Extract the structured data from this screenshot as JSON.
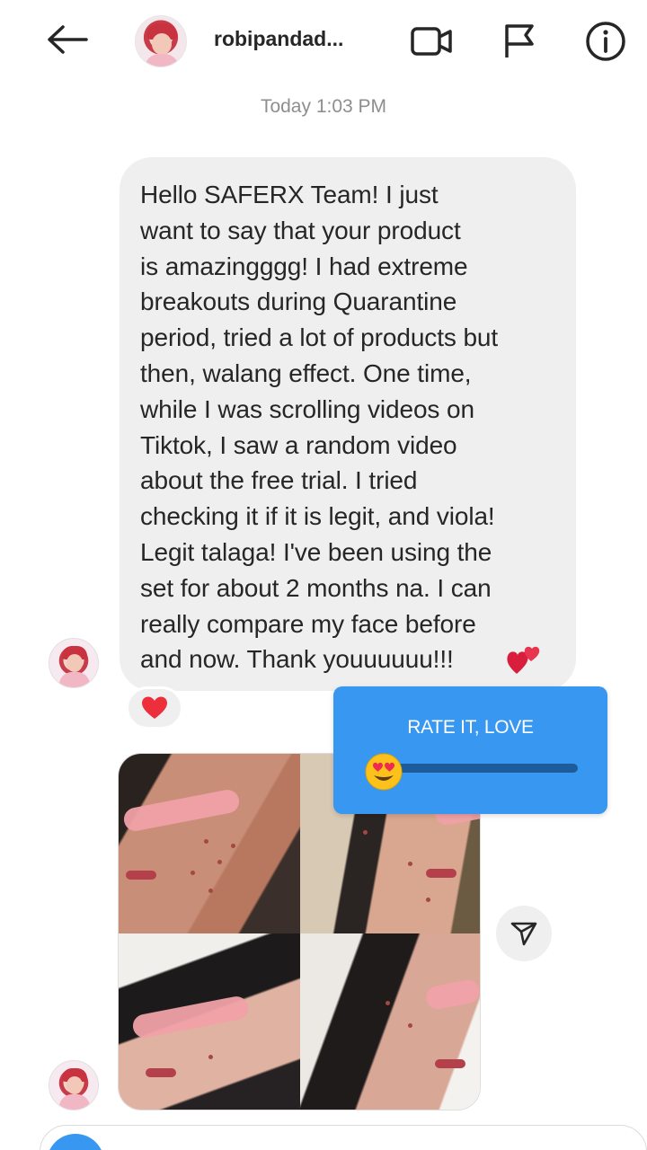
{
  "header": {
    "username": "robipandad...",
    "icons": [
      "back-arrow-icon",
      "video-call-icon",
      "flag-icon",
      "info-icon"
    ]
  },
  "timestamp": "Today 1:03 PM",
  "message": {
    "text": "Hello SAFERX Team! I just\nwant to say that your product\nis amazingggg! I had extreme\nbreakouts during Quarantine\nperiod, tried a lot of products but\nthen, walang effect. One time,\nwhile I was scrolling videos on\nTiktok, I saw a random video\nabout the free trial. I tried\nchecking it if it is legit, and viola!\nLegit talaga! I've been using the\nset for about 2 months na.  I can\nreally compare my face before\nand now. Thank youuuuuu!!!",
    "emoji": "two-hearts-emoji",
    "reaction": "heart-icon"
  },
  "rate_sticker": {
    "title": "RATE IT, LOVE",
    "emoji": "heart-eyes-emoji",
    "level": 0.05
  },
  "colors": {
    "accent": "#3897f0",
    "bubble": "#efefef",
    "heart": "#ed2f3c"
  }
}
